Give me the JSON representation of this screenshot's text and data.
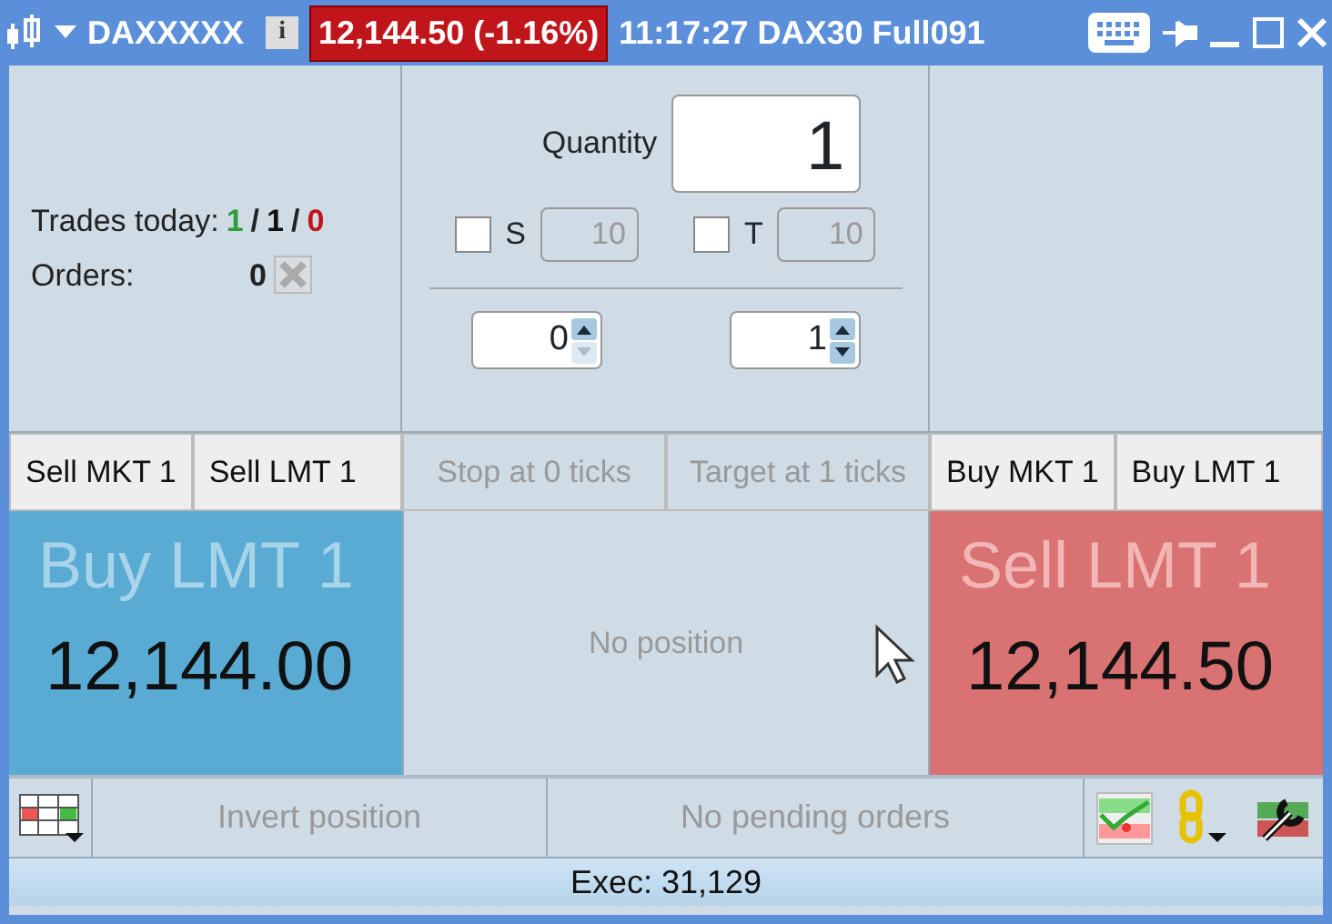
{
  "window": {
    "symbol": "DAXXXXX",
    "info_glyph": "i",
    "price_badge": "12,144.50 (-1.16%)",
    "title": "11:17:27 DAX30 Full091"
  },
  "stats": {
    "trades_label": "Trades today:",
    "trades": [
      {
        "text": "1",
        "color": "#2e9e3a"
      },
      {
        "text": "/",
        "color": "#222222"
      },
      {
        "text": "1",
        "color": "#111111"
      },
      {
        "text": "/",
        "color": "#222222"
      },
      {
        "text": "0",
        "color": "#c0161b"
      }
    ],
    "orders_label": "Orders:",
    "orders_value": "0"
  },
  "order_entry": {
    "quantity_label": "Quantity",
    "quantity": "1",
    "toggles": [
      {
        "label": "S",
        "checked": false,
        "value": "10"
      },
      {
        "label": "T",
        "checked": false,
        "value": "10"
      }
    ],
    "spinners": [
      {
        "value": "0",
        "up_enabled": true,
        "down_enabled": false
      },
      {
        "value": "1",
        "up_enabled": true,
        "down_enabled": true
      }
    ]
  },
  "left_buttons": [
    "Sell MKT 1",
    "Sell LMT 1"
  ],
  "middle_buttons": [
    {
      "label": "Stop at 0 ticks",
      "disabled": true
    },
    {
      "label": "Target at 1 ticks",
      "disabled": true
    }
  ],
  "right_buttons": [
    "Buy MKT 1",
    "Buy LMT 1"
  ],
  "bid_panel": {
    "label": "Buy LMT 1",
    "price": "12,144.00"
  },
  "position": "No position",
  "ask_panel": {
    "label": "Sell LMT 1",
    "price": "12,144.50"
  },
  "bottom": {
    "invert": "Invert position",
    "pending": "No pending orders"
  },
  "status_bar": "Exec: 31,129"
}
